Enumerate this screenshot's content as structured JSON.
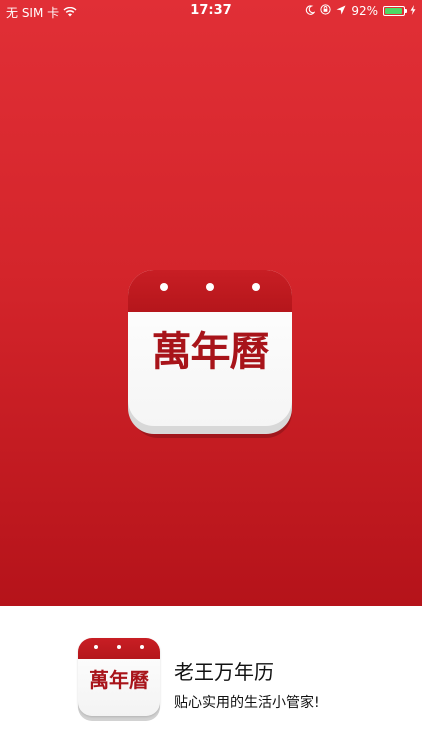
{
  "status_bar": {
    "carrier": "无 SIM 卡",
    "time": "17:37",
    "battery_percent": "92%",
    "battery_level": 0.92,
    "battery_color": "#4cd964"
  },
  "splash": {
    "logo_title": "萬年曆",
    "background_color": "#d4252b"
  },
  "footer": {
    "app_logo_title": "萬年曆",
    "app_name": "老王万年历",
    "slogan": "贴心实用的生活小管家!"
  }
}
